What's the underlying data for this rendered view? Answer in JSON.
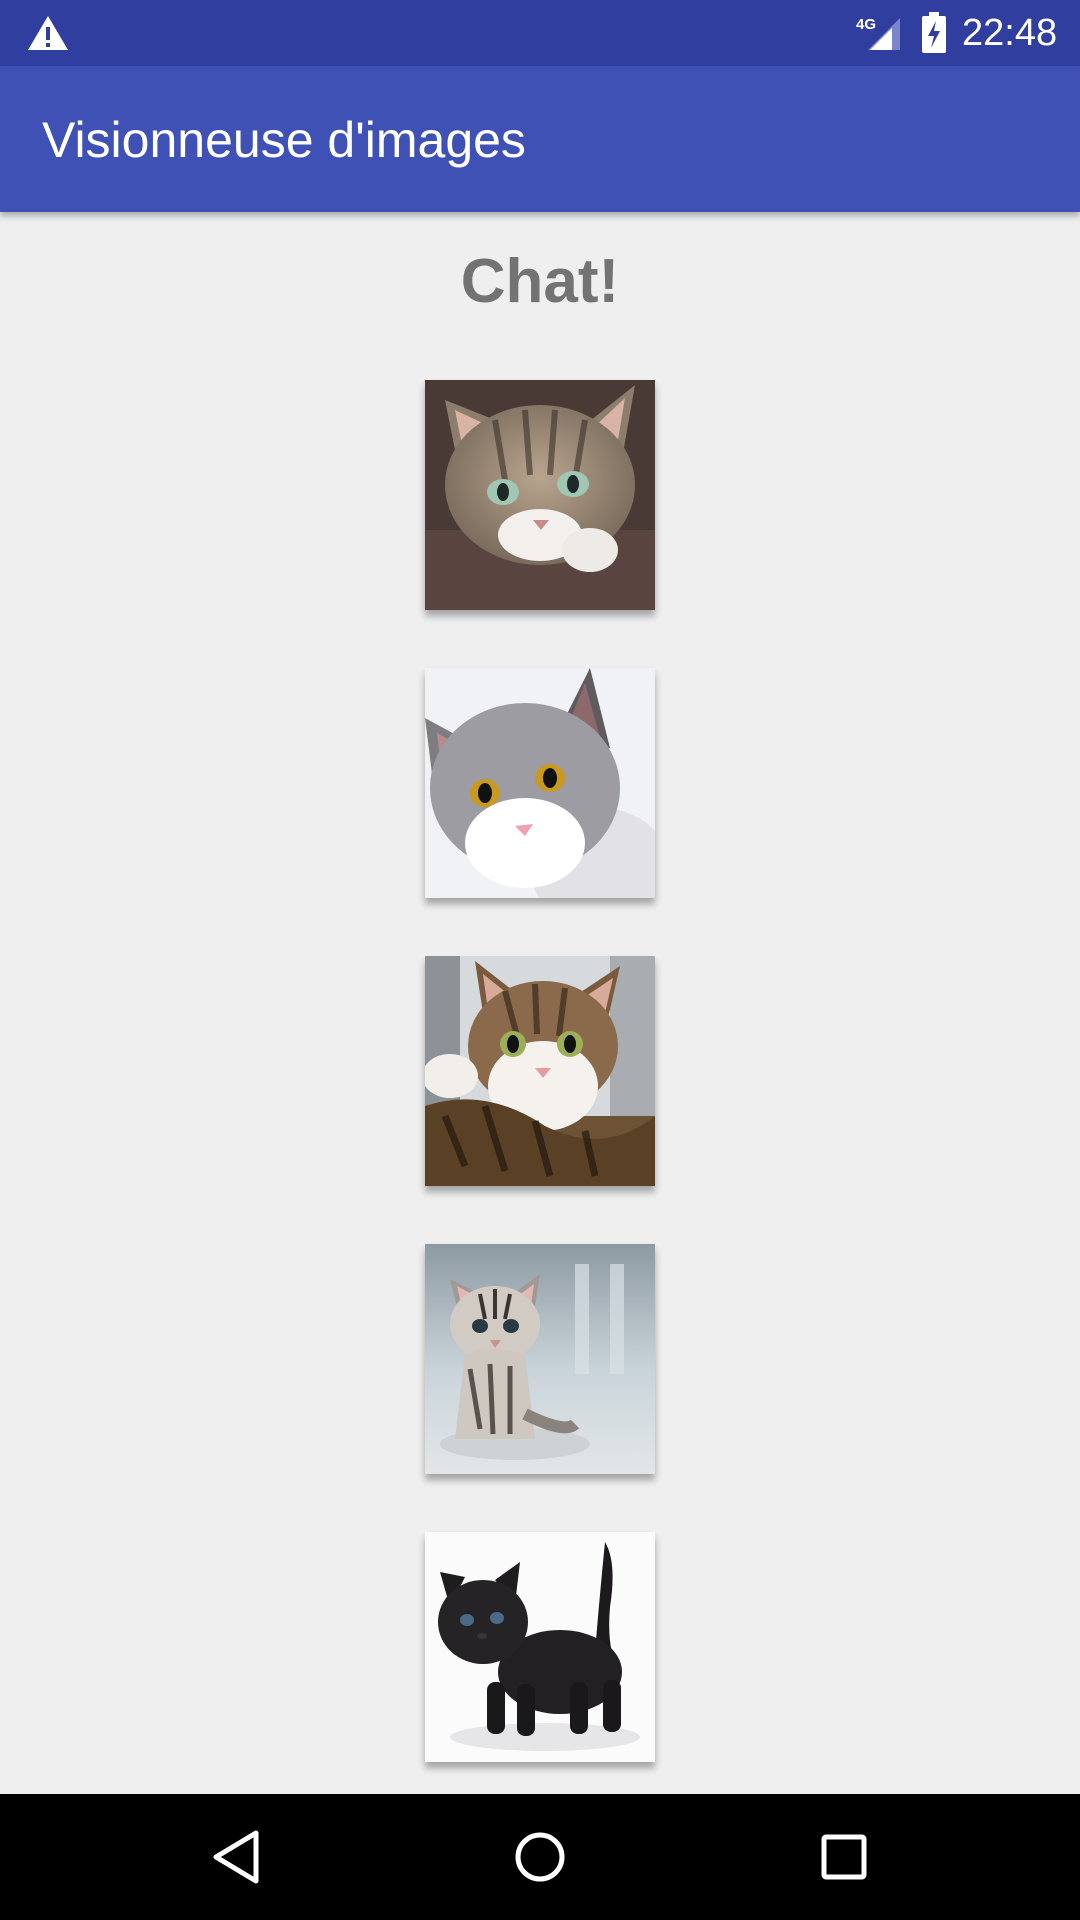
{
  "status_bar": {
    "clock": "22:48",
    "network_type": "4G",
    "icons": [
      "warning-icon",
      "signal-icon",
      "battery-charging-icon"
    ]
  },
  "app_bar": {
    "title": "Visionneuse d'images"
  },
  "main": {
    "heading": "Chat!",
    "images": [
      {
        "name": "cat-image-1",
        "subject": "tabby cat looking up"
      },
      {
        "name": "cat-image-2",
        "subject": "grey and white cat"
      },
      {
        "name": "cat-image-3",
        "subject": "brown tabby and white cat"
      },
      {
        "name": "cat-image-4",
        "subject": "silver tabby kitten"
      },
      {
        "name": "cat-image-5",
        "subject": "black kitten"
      }
    ]
  },
  "nav_bar": {
    "buttons": [
      "back-icon",
      "home-icon",
      "recents-icon"
    ]
  },
  "colors": {
    "status_bar": "#303f9f",
    "app_bar": "#3f51b5",
    "background": "#efefef",
    "heading_text": "#737373",
    "nav_bar": "#000000"
  }
}
